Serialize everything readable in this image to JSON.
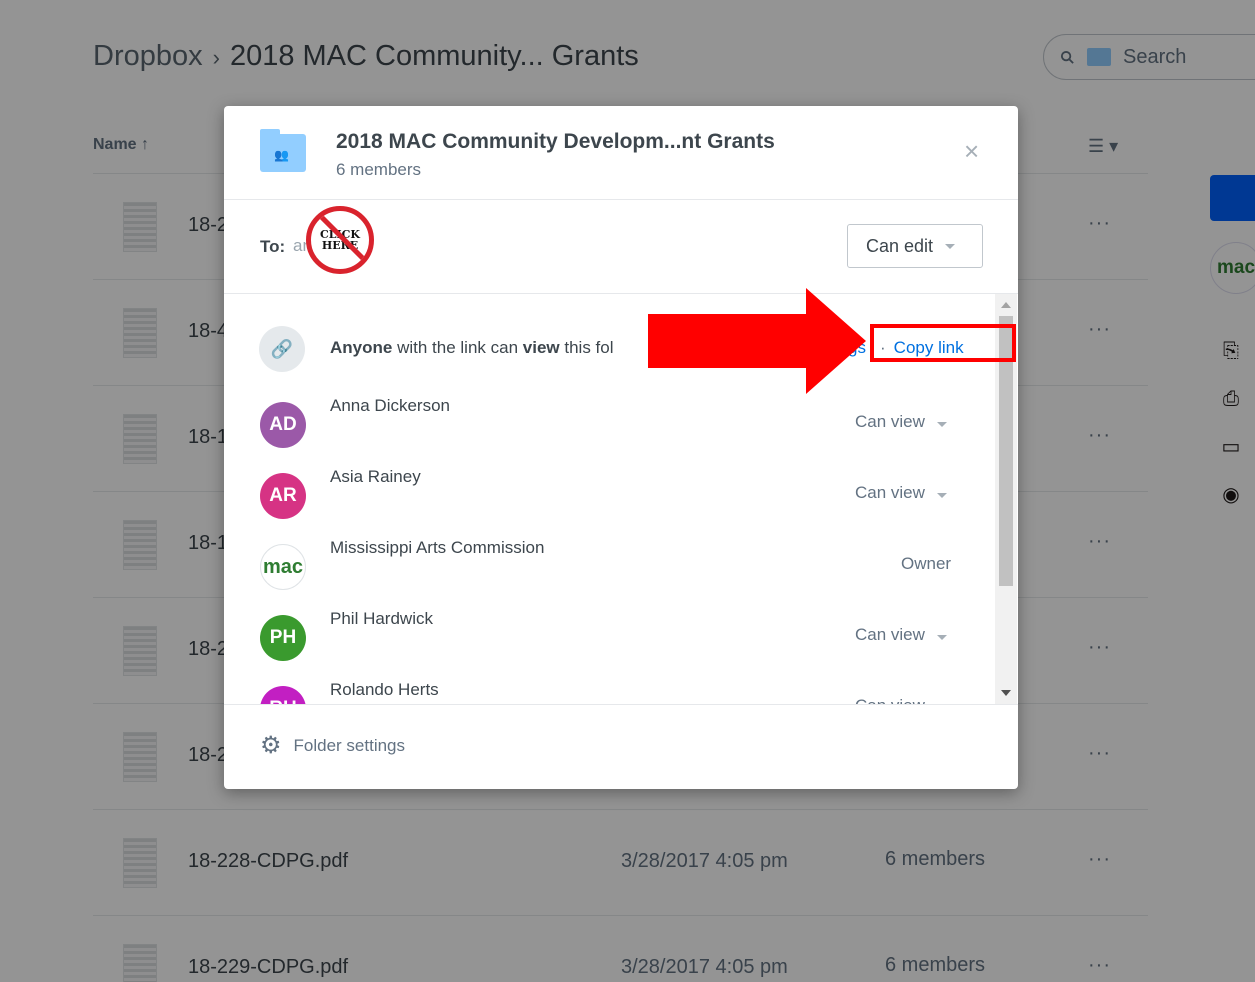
{
  "breadcrumb": {
    "root": "Dropbox",
    "separator": "›",
    "current": "2018 MAC Community... Grants"
  },
  "search": {
    "placeholder": "Search"
  },
  "columns": {
    "name": "Name ↑"
  },
  "view_toggle": "☰ ▾",
  "files": [
    {
      "name": "18-2",
      "date": "",
      "members": ""
    },
    {
      "name": "18-4",
      "date": "",
      "members": ""
    },
    {
      "name": "18-1",
      "date": "",
      "members": ""
    },
    {
      "name": "18-1",
      "date": "",
      "members": ""
    },
    {
      "name": "18-2",
      "date": "",
      "members": ""
    },
    {
      "name": "18-2",
      "date": "",
      "members": ""
    },
    {
      "name": "18-228-CDPG.pdf",
      "date": "3/28/2017 4:05 pm",
      "members": "6 members"
    },
    {
      "name": "18-229-CDPG.pdf",
      "date": "3/28/2017 4:05 pm",
      "members": "6 members"
    }
  ],
  "more_glyph": "···",
  "right_avatar": "mac",
  "modal": {
    "title": "2018 MAC Community Developm...nt Grants",
    "subtitle": "6 members",
    "close_glyph": "×",
    "to_label": "To:",
    "to_placeholder": "ame",
    "permission": "Can edit",
    "badge_text": "CLICK HERE",
    "link": {
      "anyone": "Anyone",
      "with_link": "with the link can",
      "view": "view",
      "this_folder": "this fol",
      "settings_fragment": "gs",
      "dot": "·",
      "copy": "Copy link"
    },
    "members": [
      {
        "initials": "AD",
        "name": "Anna Dickerson",
        "role": "Can view",
        "color": "#9b59a8"
      },
      {
        "initials": "AR",
        "name": "Asia Rainey",
        "role": "Can view",
        "color": "#d63384"
      },
      {
        "initials": "mac",
        "name": "Mississippi Arts Commission",
        "role": "Owner",
        "color": "#ffffff"
      },
      {
        "initials": "PH",
        "name": "Phil Hardwick",
        "role": "Can view",
        "color": "#3a9a2e"
      },
      {
        "initials": "RH",
        "name": "Rolando Herts",
        "role": "Can view",
        "color": "#c21fc2"
      }
    ],
    "folder_settings": "Folder settings"
  },
  "colors": {
    "overlay": "rgba(0,0,0,0.42)",
    "link": "#0070e0",
    "annotation": "#ff0000"
  }
}
